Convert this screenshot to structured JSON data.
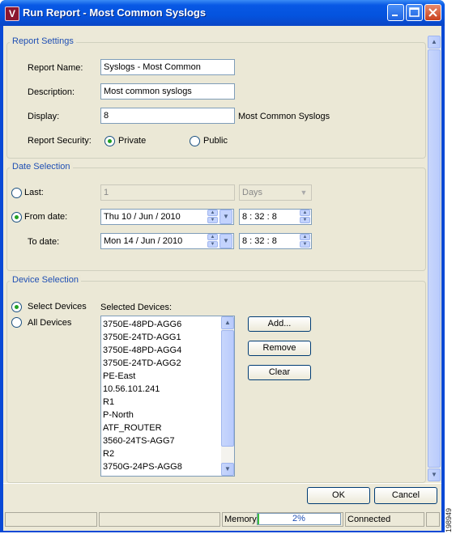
{
  "window": {
    "title": "Run Report - Most Common Syslogs",
    "app_icon_letter": "V"
  },
  "report_settings": {
    "group_title": "Report Settings",
    "report_name_label": "Report Name:",
    "report_name_value": "Syslogs - Most Common",
    "description_label": "Description:",
    "description_value": "Most common syslogs",
    "display_label": "Display:",
    "display_value": "8",
    "display_suffix": "Most Common Syslogs",
    "security_label": "Report Security:",
    "security_private": "Private",
    "security_public": "Public",
    "security_selected": "Private"
  },
  "date_selection": {
    "group_title": "Date Selection",
    "last_label": "Last:",
    "last_value": "1",
    "last_unit": "Days",
    "from_label": "From date:",
    "from_date": "Thu 10  /  Jun  /  2010",
    "from_time": "8  :  32  :  8",
    "to_label": "To date:",
    "to_date": "Mon 14  /  Jun  /  2010",
    "to_time": "8  :  32  :  8",
    "selected": "From date"
  },
  "device_selection": {
    "group_title": "Device Selection",
    "select_devices_label": "Select Devices",
    "all_devices_label": "All Devices",
    "selected_option": "Select Devices",
    "selected_devices_label": "Selected Devices:",
    "devices": [
      "3750E-48PD-AGG6",
      "3750E-24TD-AGG1",
      "3750E-48PD-AGG4",
      "3750E-24TD-AGG2",
      "PE-East",
      "10.56.101.241",
      "R1",
      "P-North",
      "ATF_ROUTER",
      "3560-24TS-AGG7",
      "R2",
      "3750G-24PS-AGG8"
    ],
    "add_button": "Add...",
    "remove_button": "Remove",
    "clear_button": "Clear"
  },
  "footer": {
    "ok_button": "OK",
    "cancel_button": "Cancel"
  },
  "status": {
    "memory_label": "Memory:",
    "memory_value": "2%",
    "connection": "Connected"
  },
  "figure_number": "198949",
  "colors": {
    "title_bar": "#0453de",
    "dialog_bg": "#ece9d8",
    "group_title": "#1f4fb4",
    "radio_dot": "#21a121"
  }
}
